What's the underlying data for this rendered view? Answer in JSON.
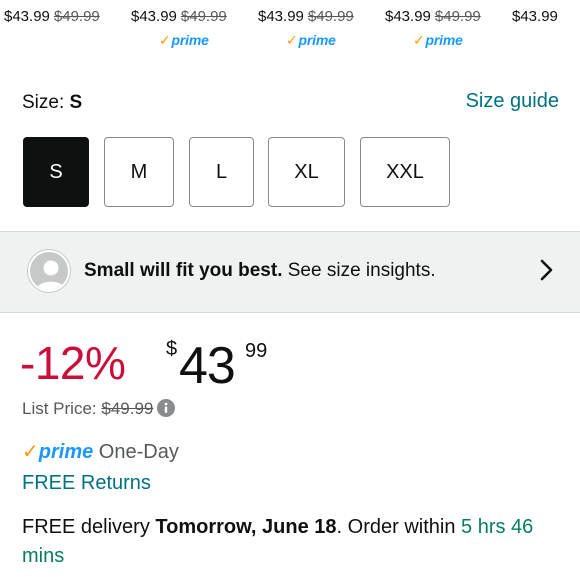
{
  "variants": [
    {
      "price": "$43.99",
      "was": "$49.99",
      "prime": false
    },
    {
      "price": "$43.99",
      "was": "$49.99",
      "prime": true
    },
    {
      "price": "$43.99",
      "was": "$49.99",
      "prime": true
    },
    {
      "price": "$43.99",
      "was": "$49.99",
      "prime": true
    },
    {
      "price": "$43.99",
      "was": "",
      "prime": false
    }
  ],
  "prime_badge": "prime",
  "size": {
    "label": "Size: ",
    "selected": "S",
    "guide_link": "Size guide",
    "options": [
      "S",
      "M",
      "L",
      "XL",
      "XXL"
    ]
  },
  "fit": {
    "bold_text": "Small will fit you best.",
    "rest_text": " See size insights."
  },
  "pricing": {
    "discount": "-12%",
    "currency_symbol": "$",
    "whole": "43",
    "fraction": "99",
    "list_price_label": "List Price: ",
    "list_price_value": "$49.99"
  },
  "shipping": {
    "prime_word": "prime",
    "prime_suffix": " One-Day",
    "free_returns": "FREE Returns",
    "delivery_prefix": "FREE delivery ",
    "delivery_date": "Tomorrow, June 18",
    "delivery_mid": ". Order within ",
    "countdown": "5 hrs 46 mins"
  },
  "colors": {
    "discount_red": "#cc0c39",
    "link_teal": "#007185",
    "prime_blue": "#1a98ff",
    "prime_orange": "#ff9900",
    "countdown_green": "#067d62"
  }
}
